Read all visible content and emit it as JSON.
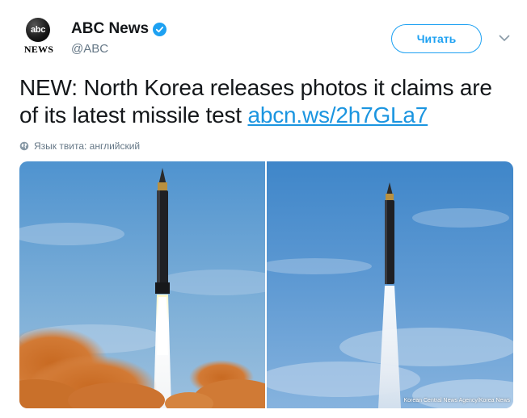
{
  "account": {
    "logo_circle_text": "abc",
    "logo_text": "NEWS",
    "display_name": "ABC News",
    "verified_icon": "verified-badge-icon",
    "handle": "@ABC"
  },
  "actions": {
    "follow_label": "Читать",
    "more_icon": "chevron-down-icon"
  },
  "tweet": {
    "text": "NEW: North Korea releases photos it claims are of its latest missile test ",
    "link_text": "abcn.ws/2h7GLa7",
    "language_note": "Язык твита: английский",
    "language_icon": "globe-icon"
  },
  "media": {
    "photos": [
      {
        "description_icon": "photo-missile-launch-smoke"
      },
      {
        "description_icon": "photo-missile-launch-sky",
        "credit": "Korean Central News Agency/Korea News"
      }
    ]
  },
  "colors": {
    "accent": "#1da1f2",
    "link": "#1b95e0",
    "text": "#14171a",
    "muted": "#657786"
  }
}
